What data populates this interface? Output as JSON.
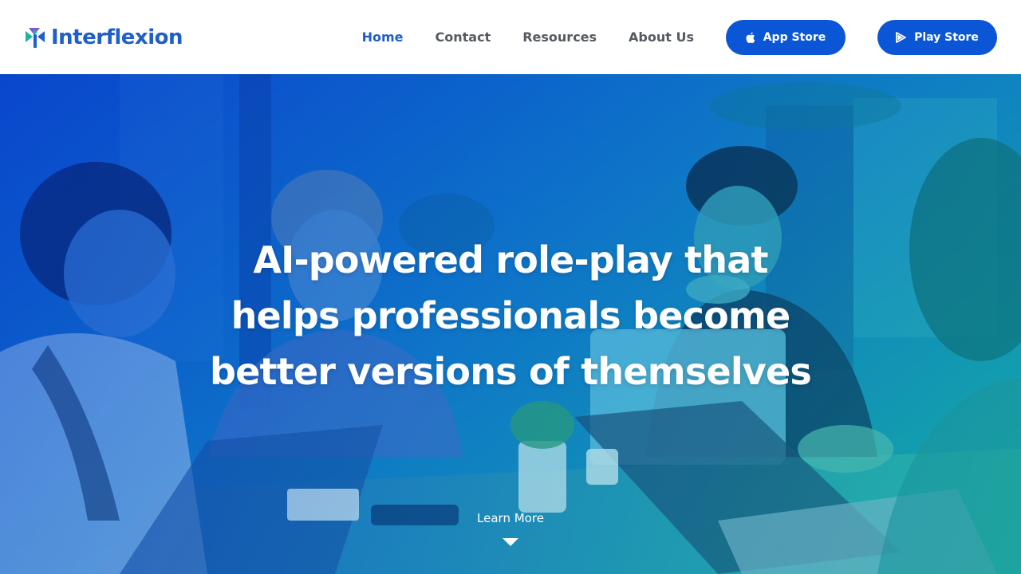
{
  "brand": {
    "name": "Interflexion",
    "colors": {
      "primary": "#1f5fc9",
      "button": "#0b56d6",
      "logo_teal": "#19b6a6",
      "logo_purple": "#7b3fd3",
      "logo_blue": "#1f5fc9"
    }
  },
  "nav": {
    "items": [
      {
        "label": "Home",
        "active": true
      },
      {
        "label": "Contact",
        "active": false
      },
      {
        "label": "Resources",
        "active": false
      },
      {
        "label": "About Us",
        "active": false
      }
    ],
    "app_store": {
      "label": "App Store",
      "icon": "apple-icon"
    },
    "play_store": {
      "label": "Play Store",
      "icon": "play-icon"
    }
  },
  "hero": {
    "title": "AI-powered role-play that helps professionals become better versions of themselves",
    "learn_more": "Learn More",
    "learn_more_icon": "caret-down-icon",
    "background": "photo of a team meeting around a table with laptops, blue-to-teal tint"
  }
}
